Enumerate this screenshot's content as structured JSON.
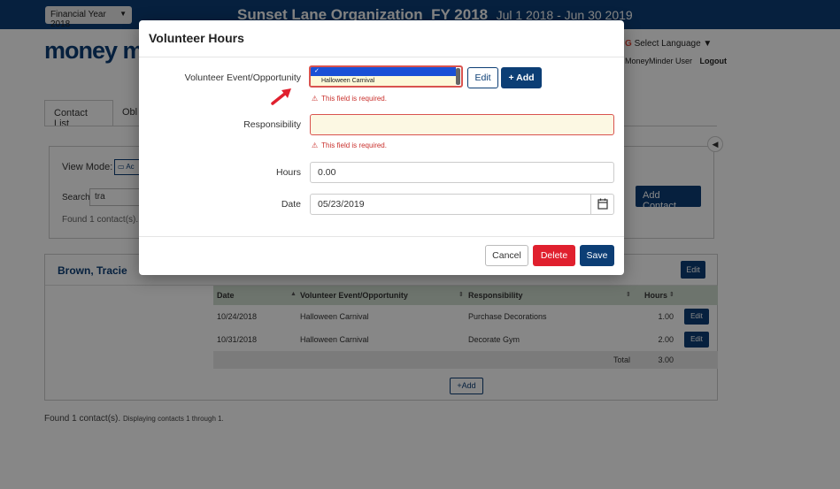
{
  "header": {
    "fy_select": "Financial Year 2018",
    "org_title": "Sunset Lane Organization",
    "fy_label": "FY 2018",
    "fy_dates": "Jul 1 2018 - Jun 30 2019",
    "logo_text": "money m",
    "language": "Select Language",
    "user": "MoneyMinder User",
    "logout": "Logout"
  },
  "tabs": [
    "Contact List",
    "Obl"
  ],
  "view": {
    "mode_label": "View Mode:",
    "mode_btn": "Ac",
    "search_label": "Search",
    "search_value": "tra",
    "found": "Found 1 contact(s).",
    "add_contact": "Add Contact"
  },
  "contact": {
    "name": "Brown, Tracie",
    "edit": "Edit",
    "table": {
      "headers": [
        "Date",
        "Volunteer Event/Opportunity",
        "Responsibility",
        "Hours"
      ],
      "rows": [
        {
          "date": "10/24/2018",
          "event": "Halloween Carnival",
          "responsibility": "Purchase Decorations",
          "hours": "1.00",
          "edit": "Edit"
        },
        {
          "date": "10/31/2018",
          "event": "Halloween Carnival",
          "responsibility": "Decorate Gym",
          "hours": "2.00",
          "edit": "Edit"
        }
      ],
      "total_label": "Total",
      "total_value": "3.00"
    },
    "add": "Add"
  },
  "footer": {
    "found": "Found 1 contact(s).",
    "displaying": "Displaying contacts 1 through 1."
  },
  "modal": {
    "title": "Volunteer Hours",
    "event_label": "Volunteer Event/Opportunity",
    "event_options": [
      "",
      "Halloween Carnival"
    ],
    "edit_btn": "Edit",
    "add_btn": "+ Add",
    "required_msg": "This field is required.",
    "responsibility_label": "Responsibility",
    "responsibility_value": "",
    "hours_label": "Hours",
    "hours_value": "0.00",
    "date_label": "Date",
    "date_value": "05/23/2019",
    "cancel": "Cancel",
    "delete": "Delete",
    "save": "Save"
  },
  "colors": {
    "brand": "#0c3e75",
    "danger": "#e0202e",
    "error_text": "#c9302c",
    "table_header": "#cfdccf"
  }
}
